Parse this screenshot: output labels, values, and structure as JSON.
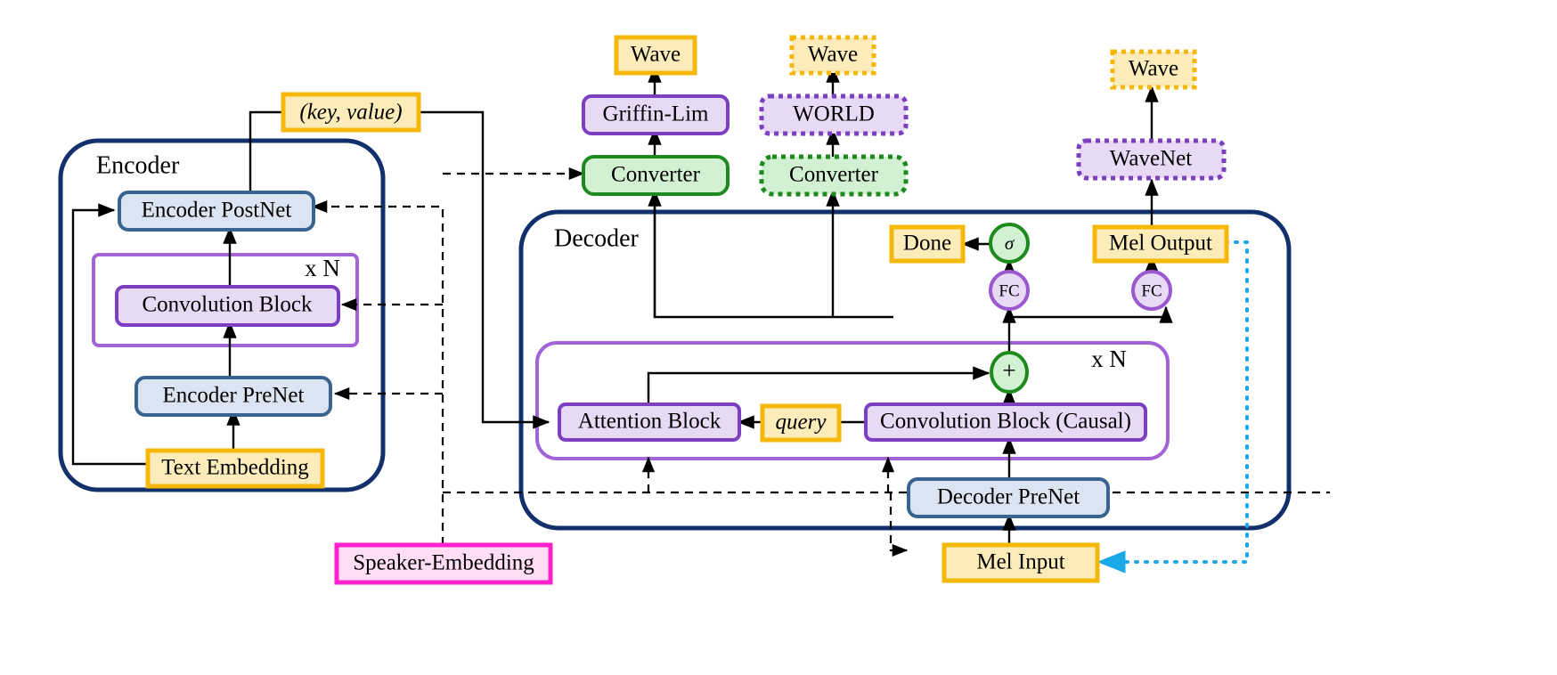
{
  "diagram": {
    "title_group_encoder": "Encoder",
    "title_group_decoder": "Decoder",
    "repeat_label_encoder": "x N",
    "repeat_label_decoder": "x N",
    "colors": {
      "navy_border": "#12306b",
      "gold_border": "#f5b70a",
      "gold_fill": "#fcecb9",
      "blue_border": "#3a6490",
      "blue_fill": "#dbe5f1",
      "purple_border": "#7b3fbf",
      "purple_fill": "#e8d9f5",
      "green_border": "#1e8a1e",
      "green_fill": "#d2f0d2",
      "magenta_border": "#ff22cc",
      "magenta_fill": "#ffddf5",
      "cyan_line": "#1aa9e8",
      "black_line": "#000000"
    },
    "nodes": {
      "key_value": "(key, value)",
      "encoder_postnet": "Encoder PostNet",
      "encoder_convblock": "Convolution Block",
      "encoder_prenet": "Encoder PreNet",
      "text_embedding": "Text Embedding",
      "wave_1": "Wave",
      "griffin_lim": "Griffin-Lim",
      "converter_1": "Converter",
      "wave_2": "Wave",
      "world": "WORLD",
      "converter_2": "Converter",
      "wave_3": "Wave",
      "wavenet": "WaveNet",
      "done": "Done",
      "sigma": "σ",
      "fc_left": "FC",
      "fc_right": "FC",
      "mel_output": "Mel Output",
      "plus": "+",
      "attention_block": "Attention Block",
      "query": "query",
      "decoder_convblock": "Convolution Block (Causal)",
      "decoder_prenet": "Decoder PreNet",
      "mel_input": "Mel Input",
      "speaker_embedding": "Speaker-Embedding"
    }
  }
}
